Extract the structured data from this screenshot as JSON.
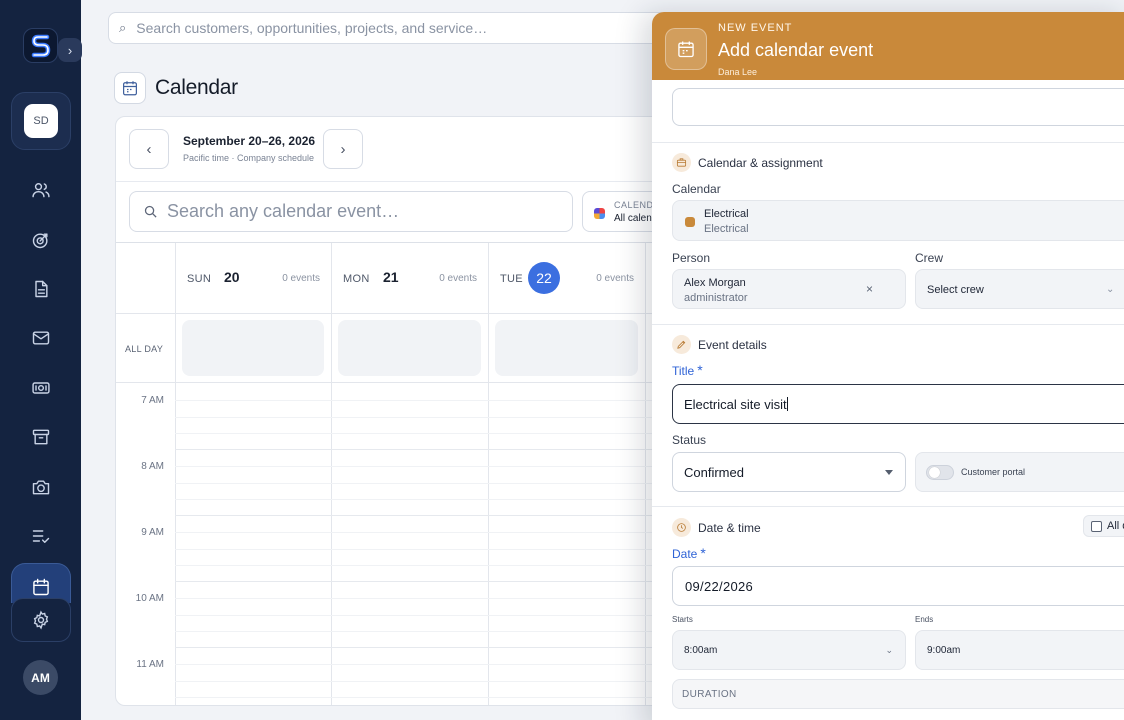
{
  "app": {
    "logo_letter": "S",
    "sidebar_expand": "›",
    "workspace_initials": "SD",
    "user_initials": "AM"
  },
  "nav_icons": [
    "users-icon",
    "target-icon",
    "document-icon",
    "mail-icon",
    "cash-icon",
    "archive-icon",
    "camera-icon",
    "checklist-icon",
    "calendar-icon",
    "gear-icon"
  ],
  "search": {
    "placeholder": "Search customers, opportunities, projects, and service…"
  },
  "page": {
    "title": "Calendar"
  },
  "calendar": {
    "range_title": "September 20–26, 2026",
    "range_subtitle": "Pacific time · Company schedule",
    "prev": "‹",
    "next": "›",
    "search_placeholder": "Search any calendar event…",
    "picker_label": "CALEND",
    "picker_value": "All calen",
    "all_day_label": "ALL DAY",
    "days": [
      {
        "name": "SUN",
        "num": "20",
        "count": "0 events",
        "today": false
      },
      {
        "name": "MON",
        "num": "21",
        "count": "0 events",
        "today": false
      },
      {
        "name": "TUE",
        "num": "22",
        "count": "0 events",
        "today": true
      }
    ],
    "hours": [
      "7 AM",
      "8 AM",
      "9 AM",
      "10 AM",
      "11 AM"
    ]
  },
  "panel": {
    "eyebrow": "NEW EVENT",
    "title": "Add calendar event",
    "owner": "Dana Lee",
    "accent": "#c9893a",
    "section_assignment": "Calendar & assignment",
    "calendar_label": "Calendar",
    "calendar_value": "Electrical",
    "calendar_value_sub": "Electrical",
    "person_label": "Person",
    "person_name": "Alex Morgan",
    "person_role": "administrator",
    "person_clear": "×",
    "crew_label": "Crew",
    "crew_value": "Select crew",
    "crew_chevron": "⌄",
    "section_details": "Event details",
    "title_label": "Title",
    "required_mark": "*",
    "title_value": "Electrical site visit",
    "status_label": "Status",
    "status_value": "Confirmed",
    "portal_label": "Customer portal",
    "section_datetime": "Date & time",
    "all_day_toggle": "All d",
    "date_label": "Date",
    "date_value": "09/22/2026",
    "starts_label": "Starts",
    "starts_value": "8:00am",
    "starts_chevron": "⌄",
    "ends_label": "Ends",
    "ends_value": "9:00am",
    "duration_label": "DURATION"
  }
}
